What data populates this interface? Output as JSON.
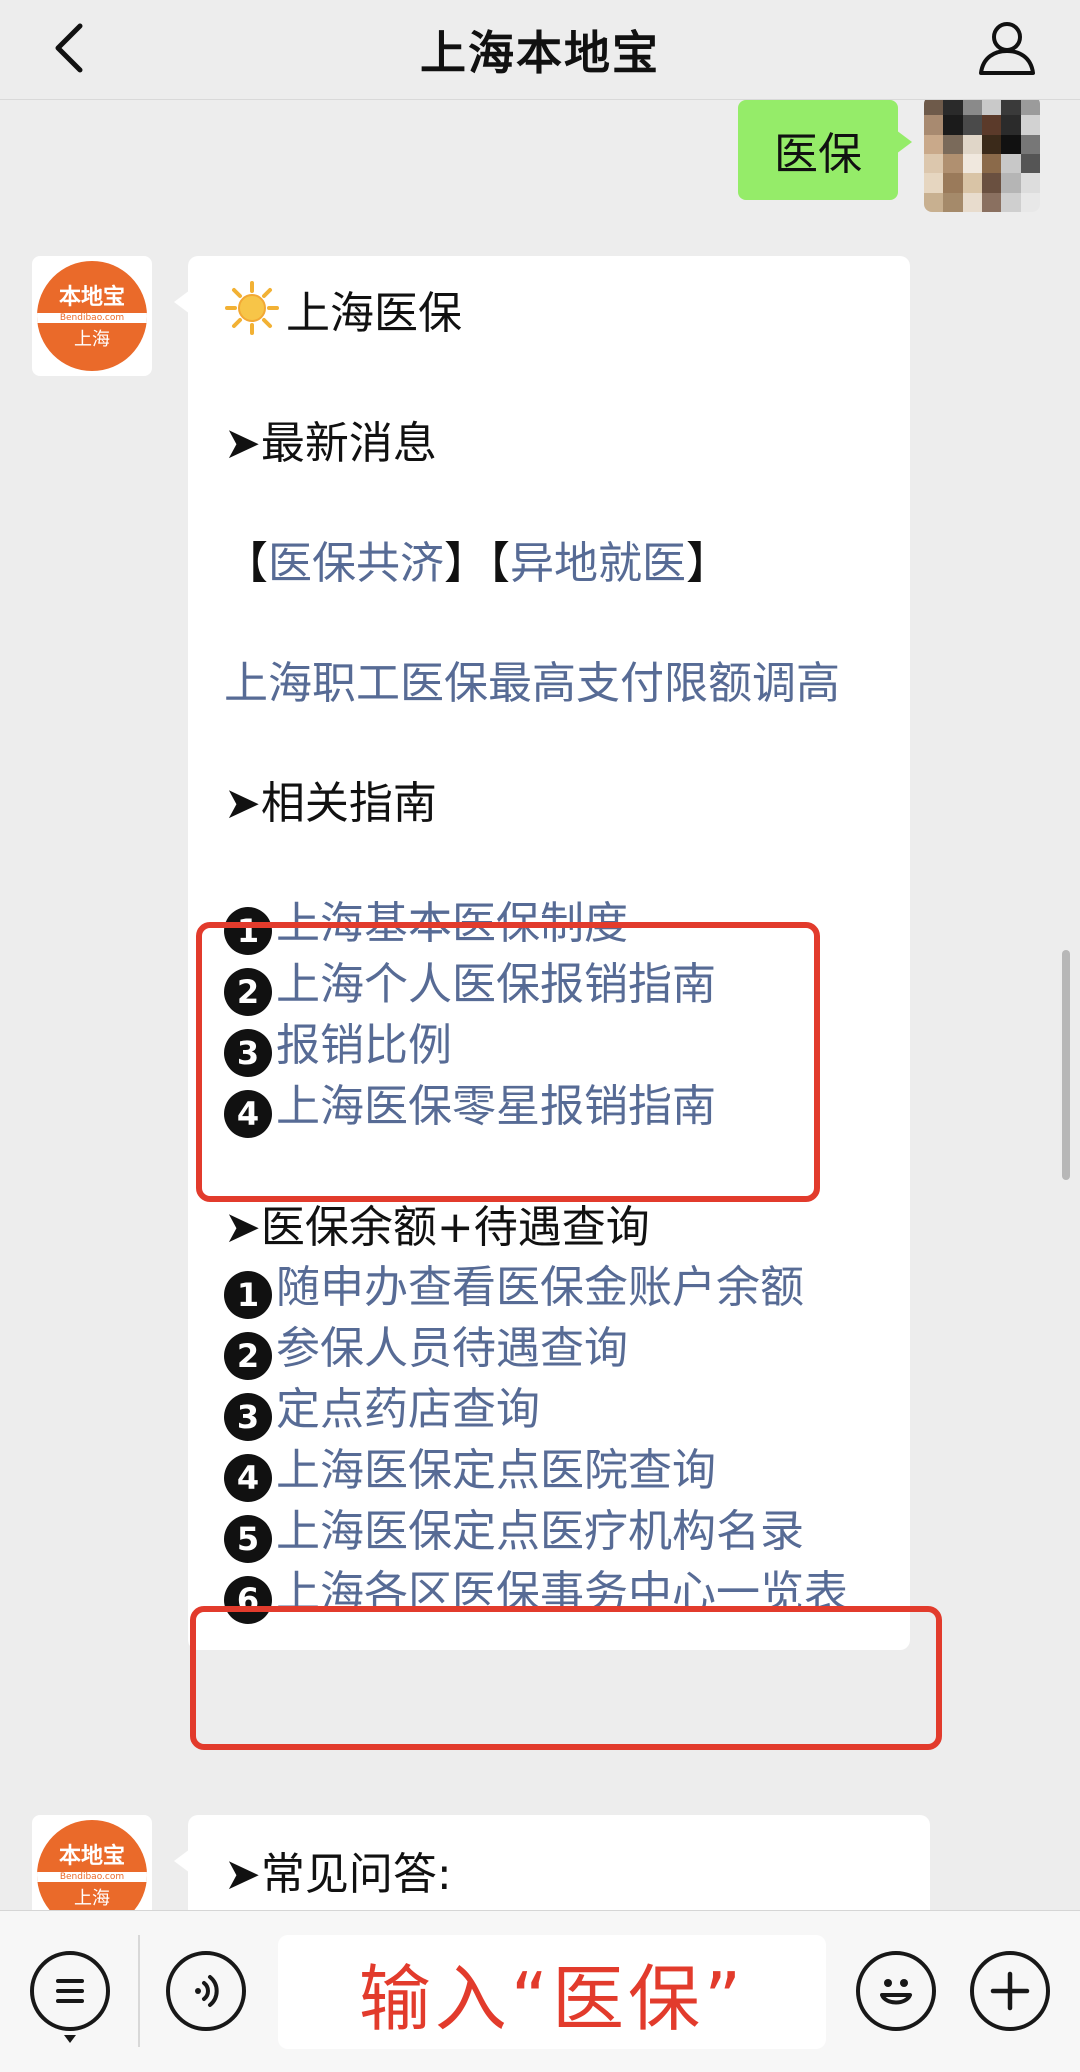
{
  "header": {
    "title": "上海本地宝"
  },
  "sent_message": {
    "text": "医保"
  },
  "bot_avatar": {
    "line1": "本地宝",
    "line2": "Bendibao.com",
    "line3": "上海"
  },
  "message1": {
    "title": "上海医保",
    "section_news": "➤最新消息",
    "tag_open1": "【",
    "tag1": "医保共济",
    "tag_close1": "】",
    "tag_open2": "【",
    "tag2": "异地就医",
    "tag_close2": "】",
    "news_link": "上海职工医保最高支付限额调高",
    "section_guide": "➤相关指南",
    "guide_items": [
      {
        "num": "1",
        "text": "上海基本医保制度"
      },
      {
        "num": "2",
        "text": "上海个人医保报销指南"
      },
      {
        "num": "3",
        "text": "报销比例"
      },
      {
        "num": "4",
        "text": "上海医保零星报销指南"
      }
    ],
    "section_query": "➤医保余额+待遇查询",
    "query_items": [
      {
        "num": "1",
        "text": "随申办查看医保金账户余额"
      },
      {
        "num": "2",
        "text": "参保人员待遇查询"
      },
      {
        "num": "3",
        "text": "定点药店查询"
      },
      {
        "num": "4",
        "text": "上海医保定点医院查询"
      },
      {
        "num": "5",
        "text": "上海医保定点医疗机构名录"
      },
      {
        "num": "6",
        "text": "上海各区医保事务中心一览表"
      }
    ]
  },
  "message2": {
    "section_faq": "➤常见问答:"
  },
  "input": {
    "text": "输入“医保”"
  },
  "colors": {
    "link": "#576b95",
    "highlight": "#e23b2c",
    "sent_bubble": "#95ec69"
  }
}
